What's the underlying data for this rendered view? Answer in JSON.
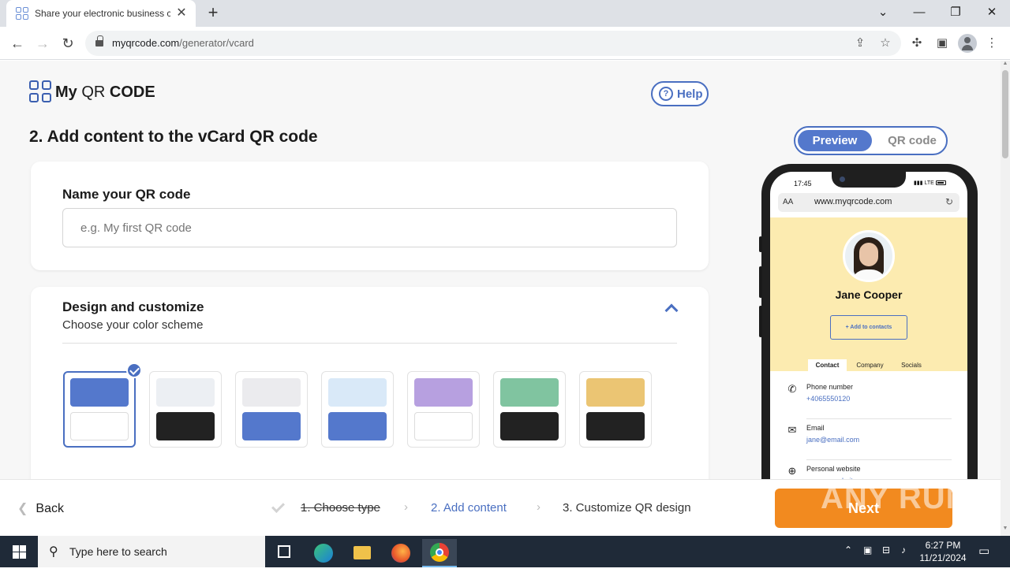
{
  "browser": {
    "tab_title": "Share your electronic business c",
    "tab_close": "✕",
    "new_tab": "+",
    "url_domain": "myqrcode.com",
    "url_path": "/generator/vcard",
    "window_controls": [
      "⌄",
      "—",
      "❐",
      "✕"
    ]
  },
  "header": {
    "logo_bold1": "My",
    "logo_light": "QR",
    "logo_bold2": "CODE",
    "help_label": "Help",
    "help_icon": "?"
  },
  "main": {
    "title": "2. Add content to the vCard QR code",
    "name_card": {
      "label": "Name your QR code",
      "placeholder": "e.g. My first QR code",
      "value": ""
    },
    "design_card": {
      "heading": "Design and customize",
      "subheading": "Choose your color scheme",
      "schemes": [
        {
          "top": "#5478cc",
          "bottom": "#ffffff",
          "selected": true
        },
        {
          "top": "#eceff3",
          "bottom": "#222222",
          "selected": false
        },
        {
          "top": "#ebebee",
          "bottom": "#5478cc",
          "selected": false
        },
        {
          "top": "#d9e9f8",
          "bottom": "#5478cc",
          "selected": false
        },
        {
          "top": "#b7a0e0",
          "bottom": "#ffffff",
          "selected": false
        },
        {
          "top": "#80c4a0",
          "bottom": "#222222",
          "selected": false
        },
        {
          "top": "#ebc573",
          "bottom": "#222222",
          "selected": false
        }
      ]
    }
  },
  "preview": {
    "toggle_active": "Preview",
    "toggle_inactive": "QR code",
    "status_time": "17:45",
    "status_right": "LTE",
    "address_aa": "AA",
    "address_url": "www.myqrcode.com",
    "contact_name": "Jane Cooper",
    "add_contacts": "+ Add to contacts",
    "tabs": [
      "Contact",
      "Company",
      "Socials"
    ],
    "rows": [
      {
        "icon": "phone-icon",
        "glyph": "✆",
        "label": "Phone number",
        "value": "+4065550120"
      },
      {
        "icon": "email-icon",
        "glyph": "✉",
        "label": "Email",
        "value": "jane@email.com"
      },
      {
        "icon": "globe-icon",
        "glyph": "⊕",
        "label": "Personal website",
        "value": "www.mywebsite.com"
      }
    ]
  },
  "stepbar": {
    "back": "Back",
    "steps": [
      "1. Choose type",
      "2. Add content",
      "3. Customize QR design"
    ],
    "next": "Next",
    "watermark": "ANY RUN"
  },
  "taskbar": {
    "search_placeholder": "Type here to search",
    "time": "6:27 PM",
    "date": "11/21/2024"
  },
  "colors": {
    "accent": "#4a6fc1",
    "next_button": "#f28a1f",
    "preview_bg": "#fcebb0"
  }
}
